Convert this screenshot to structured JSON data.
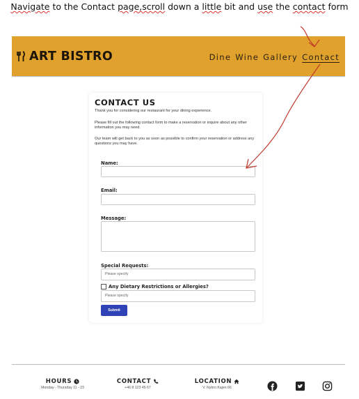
{
  "instruction": {
    "w1": "Navigate",
    "w2": " to the Contact ",
    "w3": "page,scroll",
    "w4": " down a ",
    "w5": "little",
    "w6": " bit and ",
    "w7": "use",
    "w8": " the ",
    "w9": "contact",
    "w10": " form"
  },
  "header": {
    "logo_text": "ART BISTRO",
    "nav": [
      "Dine",
      "Wine",
      "Gallery",
      "Contact"
    ],
    "active_nav": "Contact",
    "bg_color": "#e0a22c"
  },
  "contact": {
    "title": "CONTACT US",
    "p1": "Thank you for considering our restaurant for your dining experience.",
    "p2": "Please fill out the following contact form to make a reservation or inquire about any other information you may need.",
    "p3": "Our team will get back to you as soon as possible to confirm your reservation or address any questions you may have.",
    "name_label": "Name:",
    "email_label": "Email:",
    "message_label": "Message:",
    "special_label": "Special Requests:",
    "special_placeholder": "Please specify",
    "dietary_label": "Any Dietary Restrictions or Allergies?",
    "dietary_placeholder": "Please specify",
    "submit_label": "Submit",
    "button_color": "#2f43b7"
  },
  "footer": {
    "hours_title": "HOURS",
    "hours_text": "Monday - Thursday 11 - 23",
    "contact_title": "CONTACT",
    "contact_text": "+46 8 123 45 67",
    "location_title": "LOCATION",
    "location_text": "V. Nybro Kajen 66",
    "social": [
      "facebook-icon",
      "twitter-icon",
      "instagram-icon"
    ]
  },
  "annotation_color": "#c0392b"
}
